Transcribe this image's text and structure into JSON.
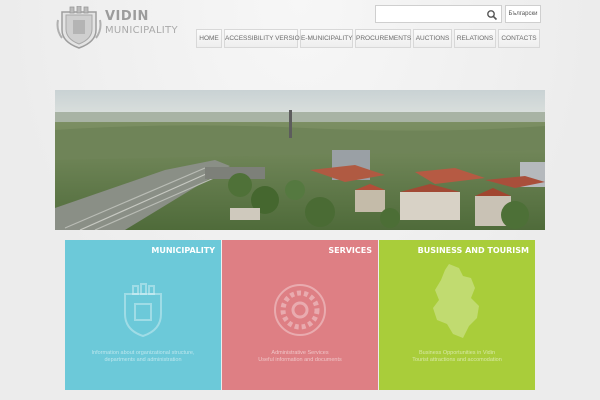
{
  "brand": {
    "title": "VIDIN",
    "subtitle": "MUNICIPALITY"
  },
  "search": {
    "value": "",
    "placeholder": ""
  },
  "language": {
    "label": "Български"
  },
  "nav": [
    {
      "label": "HOME"
    },
    {
      "label": "ACCESSIBILITY VERSION"
    },
    {
      "label": "E-MUNICIPALITY"
    },
    {
      "label": "PROCUREMENTS"
    },
    {
      "label": "AUCTIONS"
    },
    {
      "label": "RELATIONS"
    },
    {
      "label": "CONTACTS"
    }
  ],
  "tiles": [
    {
      "title": "MUNICIPALITY",
      "line1": "Information about organizational structure,",
      "line2": "departments and administration",
      "color": "#6cc9d9",
      "icon": "coat-of-arms-icon"
    },
    {
      "title": "SERVICES",
      "line1": "Administrative Services",
      "line2": "Useful information and documents",
      "color": "#de7f84",
      "icon": "gear-icon"
    },
    {
      "title": "BUSINESS AND TOURISM",
      "line1": "Business Opportunities in Vidin",
      "line2": "Tourist attractions and accomodation",
      "color": "#a9cd3a",
      "icon": "map-icon"
    }
  ]
}
